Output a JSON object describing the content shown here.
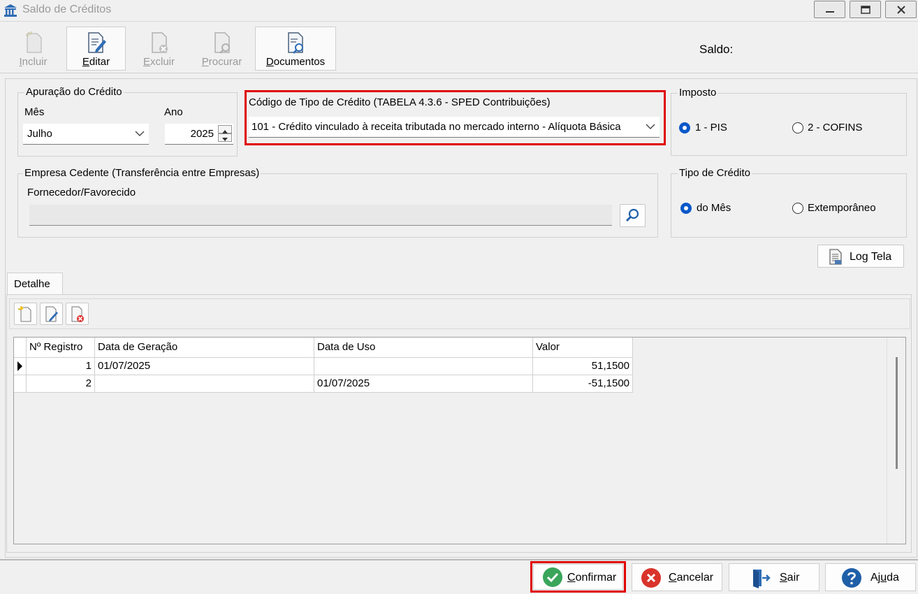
{
  "window": {
    "title": "Saldo de Créditos"
  },
  "toolbar": {
    "incluir_rest": "ncluir",
    "incluir_acc": "I",
    "editar_rest": "ditar",
    "editar_acc": "E",
    "excluir_rest": "xcluir",
    "excluir_acc": "E",
    "procurar_rest": "rocurar",
    "procurar_acc": "P",
    "documentos_rest": "ocumentos",
    "documentos_acc": "D",
    "saldo_label": "Saldo:"
  },
  "apuracao": {
    "title": "Apuração do Crédito",
    "mes_label": "Mês",
    "mes_value": "Julho",
    "ano_label": "Ano",
    "ano_value": "2025"
  },
  "codigo": {
    "title": "Código de Tipo de Crédito (TABELA 4.3.6 -  SPED Contribuições)",
    "value": "101 - Crédito vinculado à receita tributada no mercado interno - Alíquota Básica"
  },
  "imposto": {
    "title": "Imposto",
    "option1": "1 - PIS",
    "option2": "2 - COFINS",
    "selected": "1 - PIS"
  },
  "empresa": {
    "title": "Empresa Cedente (Transferência entre Empresas)",
    "fornecedor_label": "Fornecedor/Favorecido",
    "fornecedor_value": ""
  },
  "tipo_credito": {
    "title": "Tipo de Crédito",
    "option1": "do Mês",
    "option2": "Extemporâneo",
    "selected": "do Mês"
  },
  "log_tela": "Log Tela",
  "detalhe_tab": "Detalhe",
  "grid": {
    "columns": [
      "Nº Registro",
      "Data de Geração",
      "Data de Uso",
      "Valor"
    ],
    "rows": [
      {
        "registro": "1",
        "geracao": "01/07/2025",
        "uso": "",
        "valor": "51,1500"
      },
      {
        "registro": "2",
        "geracao": "",
        "uso": "01/07/2025",
        "valor": "-51,1500"
      }
    ]
  },
  "bottom": {
    "confirmar_acc": "C",
    "confirmar_rest": "onfirmar",
    "cancelar_acc": "C",
    "cancelar_rest": "ancelar",
    "sair_acc": "S",
    "sair_rest": "air",
    "ajuda_pre": "Aj",
    "ajuda_acc": "u",
    "ajuda_post": "da"
  }
}
